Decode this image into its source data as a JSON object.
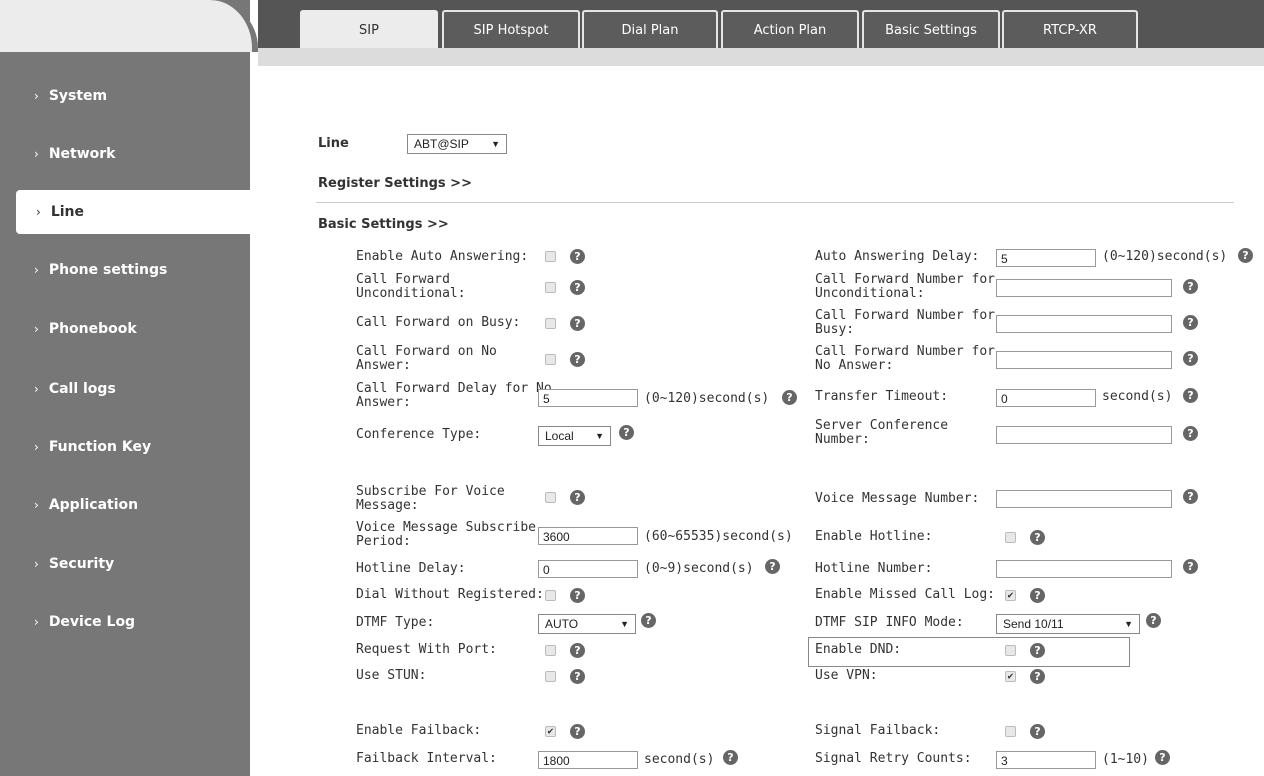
{
  "nav": [
    "System",
    "Network",
    "Line",
    "Phone settings",
    "Phonebook",
    "Call logs",
    "Function Key",
    "Application",
    "Security",
    "Device Log"
  ],
  "tabs": [
    "SIP",
    "SIP Hotspot",
    "Dial Plan",
    "Action Plan",
    "Basic Settings",
    "RTCP-XR"
  ],
  "line_label": "Line",
  "line_value": "ABT@SIP",
  "register_settings": "Register Settings >>",
  "basic_settings": "Basic Settings >>",
  "left": {
    "enable_auto_answering": "Enable Auto Answering:",
    "cf_unconditional": [
      "Call Forward",
      "Unconditional:"
    ],
    "cf_busy": "Call Forward on Busy:",
    "cf_no_answer": [
      "Call Forward on No",
      "Answer:"
    ],
    "cf_delay": [
      "Call Forward Delay for No",
      "Answer:"
    ],
    "cf_delay_value": "5",
    "cf_delay_unit": "(0~120)second(s)",
    "conference_type": "Conference Type:",
    "conference_type_value": "Local",
    "subscribe_voice": [
      "Subscribe For Voice",
      "Message:"
    ],
    "vm_period": [
      "Voice Message Subscribe",
      "Period:"
    ],
    "vm_period_value": "3600",
    "vm_period_unit": "(60~65535)second(s)",
    "hotline_delay": "Hotline Delay:",
    "hotline_delay_value": "0",
    "hotline_delay_unit": "(0~9)second(s)",
    "dial_without_registered": "Dial Without Registered:",
    "dtmf_type": "DTMF Type:",
    "dtmf_type_value": "AUTO",
    "request_with_port": "Request With Port:",
    "use_stun": "Use STUN:",
    "enable_failback": "Enable Failback:",
    "failback_interval": "Failback Interval:",
    "failback_interval_value": "1800",
    "failback_interval_unit": "second(s)"
  },
  "right": {
    "auto_answer_delay": "Auto Answering Delay:",
    "auto_answer_delay_value": "5",
    "auto_answer_delay_unit": "(0~120)second(s)",
    "cfn_unconditional": [
      "Call Forward Number for",
      "Unconditional:"
    ],
    "cfn_busy": [
      "Call Forward Number for",
      "Busy:"
    ],
    "cfn_no_answer": [
      "Call Forward Number for",
      "No Answer:"
    ],
    "transfer_timeout": "Transfer Timeout:",
    "transfer_timeout_value": "0",
    "transfer_timeout_unit": "second(s)",
    "server_conf": [
      "Server Conference",
      "Number:"
    ],
    "vm_number": "Voice Message Number:",
    "enable_hotline": "Enable Hotline:",
    "hotline_number": "Hotline Number:",
    "enable_missed_call_log": "Enable Missed Call Log:",
    "dtmf_sip_info_mode": "DTMF SIP INFO Mode:",
    "dtmf_sip_info_mode_value": "Send 10/11",
    "enable_dnd": "Enable DND:",
    "use_vpn": "Use VPN:",
    "signal_failback": "Signal Failback:",
    "signal_retry_counts": "Signal Retry Counts:",
    "signal_retry_counts_value": "3",
    "signal_retry_counts_unit": "(1~10)"
  },
  "checks": {
    "enable_auto_answering": false,
    "cf_unconditional": false,
    "cf_busy": false,
    "cf_no_answer": false,
    "subscribe_voice": false,
    "enable_hotline": false,
    "dial_without_registered": false,
    "enable_missed_call_log": true,
    "request_with_port": false,
    "enable_dnd": false,
    "use_stun": false,
    "use_vpn": true,
    "enable_failback": true,
    "signal_failback": false
  },
  "icons": {
    "help": "?",
    "check": "✔",
    "arrow": "▼",
    "chevron": "›"
  }
}
